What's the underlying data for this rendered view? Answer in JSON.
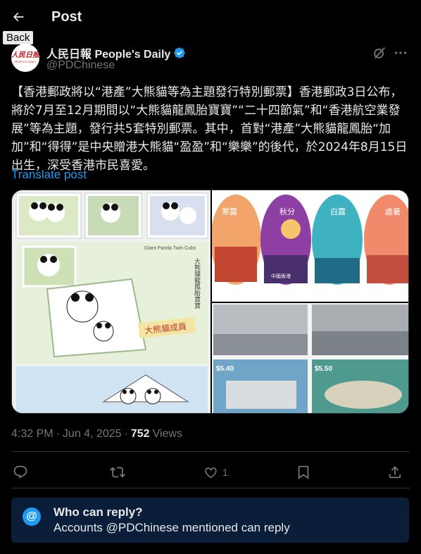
{
  "header": {
    "title": "Post",
    "back_tooltip": "Back"
  },
  "author": {
    "display_name": "人民日報 People's Daily",
    "handle": "@PDChinese",
    "avatar_logo_cn": "人民日报",
    "avatar_logo_en": "PEOPLE'S DAILY",
    "verified": true
  },
  "post": {
    "text": "【香港郵政將以“港產”大熊貓等為主題發行特別郵票】香港郵政3日公布，將於7月至12月期間以“大熊貓龍鳳胎寶寶”“二十四節氣”和“香港航空業發展”等為主題，發行共5套特別郵票。其中，首對“港產”大熊貓龍鳳胎“加加”和“得得”是中央贈港大熊貓“盈盈”和“樂樂”的後代，於2024年8月15日出生，深受香港市民喜愛。",
    "translate_label": "Translate post",
    "time": "4:32 PM",
    "date": "Jun 4, 2025",
    "views_count": "752",
    "views_label": "Views"
  },
  "media": {
    "stamp_texts": {
      "panda_title": "Giant Panda Twin Cubs",
      "panda_badge": "大熊貓成員",
      "panda_cn": "大熊貓龍鳳胎寶寶",
      "term_1": "寒露",
      "term_2": "秋分",
      "term_3": "白露",
      "term_4": "處暑",
      "country": "中國香港",
      "price_1": "$5.40",
      "price_2": "$5.50"
    }
  },
  "actions": {
    "like_count": "1"
  },
  "reply_settings": {
    "title": "Who can reply?",
    "subtitle": "Accounts @PDChinese mentioned can reply",
    "icon": "@"
  },
  "colors": {
    "accent": "#1d9bf0",
    "background": "#000000",
    "muted": "#71767b"
  }
}
